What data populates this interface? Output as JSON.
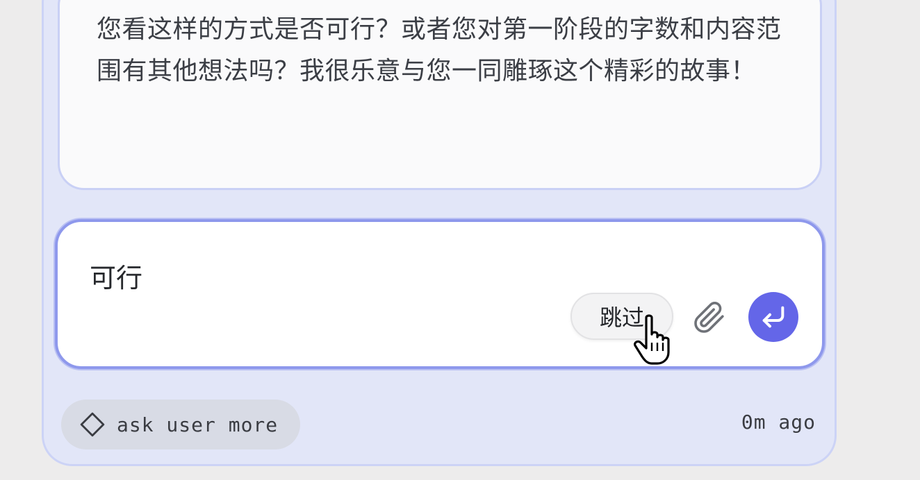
{
  "message": {
    "text": "您看这样的方式是否可行？或者您对第一阶段的字数和内容范围有其他想法吗？我很乐意与您一同雕琢这个精彩的故事！"
  },
  "input": {
    "value": "可行",
    "skip_label": "跳过",
    "attach_icon": "paperclip-icon",
    "send_icon": "return-arrow-icon"
  },
  "footer": {
    "tag_icon": "diamond-icon",
    "tag_label": "ask user more",
    "time": "0m ago"
  },
  "colors": {
    "accent": "#6466e8",
    "card_bg": "#e2e6f8",
    "input_border": "#8e98ec"
  }
}
